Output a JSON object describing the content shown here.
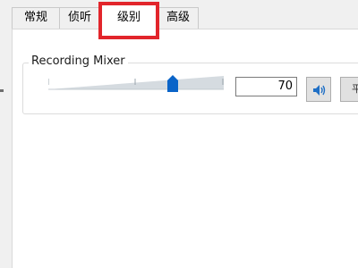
{
  "tabs": [
    {
      "label": "常规"
    },
    {
      "label": "侦听"
    },
    {
      "label": "级别"
    },
    {
      "label": "高级"
    }
  ],
  "active_tab": "级别",
  "highlight_color": "#e2252b",
  "level_group": {
    "title": "Recording Mixer",
    "level_percent": 70,
    "value_text": "70",
    "mute_icon": "speaker-icon",
    "balance_label": "平"
  },
  "colors": {
    "accent": "#0a64c8",
    "slider_track": "#d5dbe0"
  }
}
